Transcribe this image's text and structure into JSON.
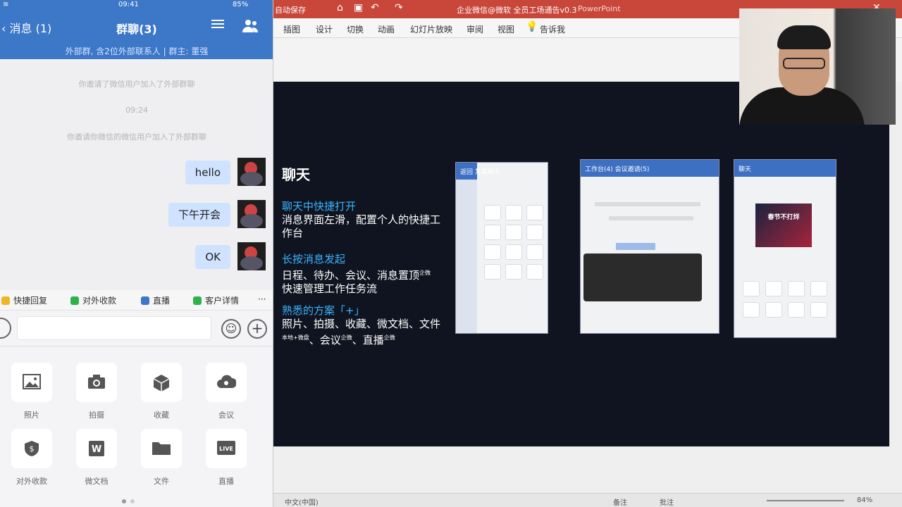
{
  "phone": {
    "status_time": "09:41",
    "status_battery": "85%",
    "nav": {
      "back_label": "消息 (1)",
      "title": "群聊(3)"
    },
    "subheader": "外部群, 含2位外部联系人 | 群主: 董强",
    "system_messages": [
      "你邀请了微信用户加入了外部群聊",
      "09:24",
      "你邀请你微信的微信用户加入了外部群聊"
    ],
    "messages": [
      {
        "text": "hello"
      },
      {
        "text": "下午开会"
      },
      {
        "text": "OK"
      }
    ],
    "toolbar": [
      {
        "label": "快捷回复",
        "color": "#f0b429"
      },
      {
        "label": "对外收款",
        "color": "#2fb24c"
      },
      {
        "label": "直播",
        "color": "#3c77c8"
      },
      {
        "label": "客户详情",
        "color": "#2fb24c"
      }
    ],
    "more_label": "···",
    "voice_label": "))",
    "emoji_label": "☺",
    "plus_label": "+",
    "panel": [
      {
        "label": "照片",
        "icon": "image-icon"
      },
      {
        "label": "拍摄",
        "icon": "camera-icon"
      },
      {
        "label": "收藏",
        "icon": "cube-icon"
      },
      {
        "label": "会议",
        "icon": "cloud-icon"
      },
      {
        "label": "对外收款",
        "icon": "shield-icon"
      },
      {
        "label": "微文档",
        "icon": "word-doc-icon"
      },
      {
        "label": "文件",
        "icon": "folder-icon"
      },
      {
        "label": "直播",
        "icon": "live-icon"
      }
    ],
    "panel_badges": {
      "shield": "$",
      "word": "W",
      "live": "LIVE"
    }
  },
  "ppt": {
    "titlebar": {
      "autosave": "自动保存",
      "doc_title": "企业微信@微软 全员工场通告v0.3",
      "app_name": "PowerPoint",
      "close": "✕"
    },
    "ribbon_tabs": [
      "插图",
      "设计",
      "切换",
      "动画",
      "幻灯片放映",
      "审阅",
      "视图"
    ],
    "tell_me": "告诉我",
    "slide": {
      "heading": "聊天",
      "blocks": [
        {
          "title": "聊天中快捷打开",
          "body": "消息界面左滑，配置个人的快捷工作台"
        },
        {
          "title": "长按消息发起",
          "body": "日程、待办、会议、消息置顶",
          "body_sup": "企微",
          "body2": "快速管理工作任务流"
        },
        {
          "title": "熟悉的方案「+」",
          "body": "照片、拍摄、收藏、微文档、文件",
          "body_sup": "本地+微盘",
          "body2": "、会议",
          "body2_sup": "企微",
          "body3": "、直播",
          "body3_sup": "企微"
        }
      ],
      "thumb1_bar": "返回  某某聊天",
      "thumb2_bar": "工作台(4)    会议邀请(5)",
      "thumb3_bar": "聊天",
      "thumb3_poster": "春节不打烊"
    },
    "status_left": "中文(中国)",
    "status_notes": "备注",
    "status_comments": "批注",
    "status_zoom": "84%"
  }
}
